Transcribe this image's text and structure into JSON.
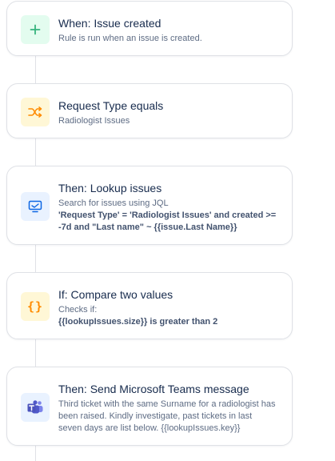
{
  "steps": [
    {
      "title": "When: Issue created",
      "description": "Rule is run when an issue is created.",
      "icon": "plus-icon",
      "icon_bg": "#e3fcef",
      "icon_color": "#36b37e"
    },
    {
      "title": "Request Type equals",
      "description": "Radiologist Issues",
      "icon": "shuffle-icon",
      "icon_bg": "#fff7d6",
      "icon_color": "#ff8b00"
    },
    {
      "title": "Then: Lookup issues",
      "description": "Search for issues using JQL",
      "query": "'Request Type' = 'Radiologist Issues' and created >= -7d and \"Last name\" ~ {{issue.Last Name}}",
      "icon": "monitor-icon",
      "icon_bg": "#e9f2ff",
      "icon_color": "#0c66e4"
    },
    {
      "title": "If: Compare two values",
      "description": "Checks if:",
      "condition": "{{lookupIssues.size}} is greater than 2",
      "icon": "braces-icon",
      "icon_bg": "#fff7d6",
      "icon_color": "#ff8b00"
    },
    {
      "title": "Then: Send Microsoft Teams message",
      "description": "Third ticket with the same Surname for a radiologist has been raised. Kindly investigate, past tickets in last seven days are list below. {{lookupIssues.key}}",
      "icon": "microsoft-teams-icon",
      "icon_bg": "#e9f2ff",
      "icon_color": "#5059c9"
    }
  ]
}
